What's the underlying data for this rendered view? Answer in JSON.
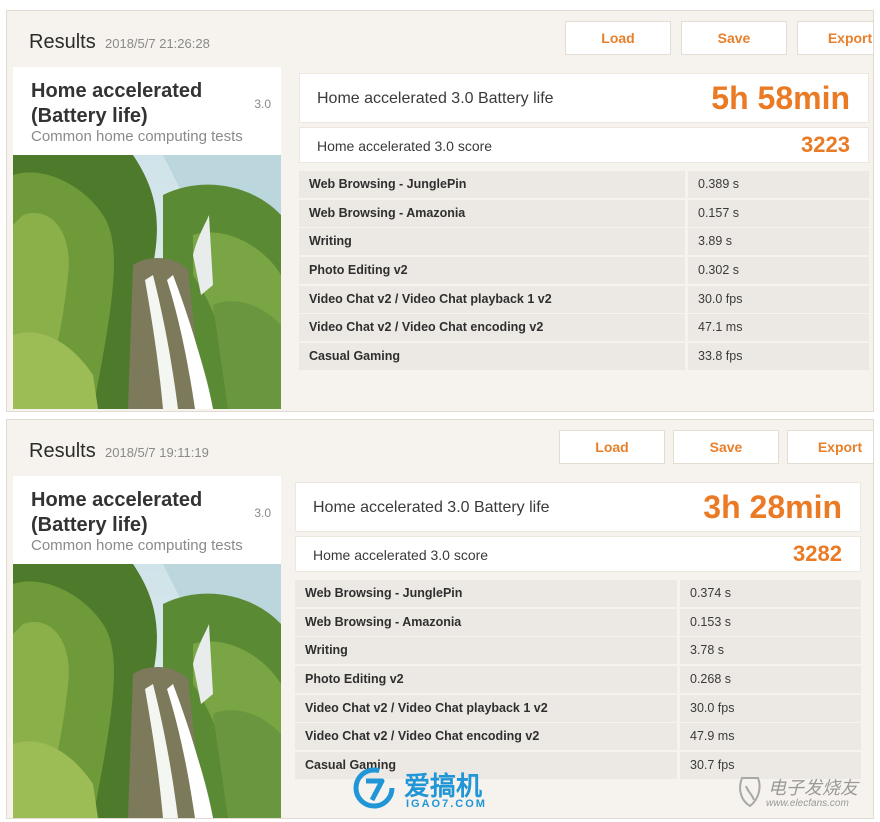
{
  "panels": [
    {
      "header": {
        "title": "Results",
        "date": "2018/5/7 21:26:28"
      },
      "buttons": {
        "load": "Load",
        "save": "Save",
        "export": "Export"
      },
      "test": {
        "name": "Home accelerated (Battery life)",
        "version": "3.0",
        "description": "Common home computing tests"
      },
      "battery": {
        "label": "Home accelerated 3.0 Battery life",
        "value": "5h 58min"
      },
      "score": {
        "label": "Home accelerated 3.0 score",
        "value": "3223"
      },
      "metrics": [
        {
          "name": "Web Browsing - JunglePin",
          "value": "0.389 s"
        },
        {
          "name": "Web Browsing - Amazonia",
          "value": "0.157 s"
        },
        {
          "name": "Writing",
          "value": "3.89 s"
        },
        {
          "name": "Photo Editing v2",
          "value": "0.302 s"
        },
        {
          "name": "Video Chat v2 / Video Chat playback 1 v2",
          "value": "30.0 fps"
        },
        {
          "name": "Video Chat v2 / Video Chat encoding v2",
          "value": "47.1 ms"
        },
        {
          "name": "Casual Gaming",
          "value": "33.8 fps"
        }
      ]
    },
    {
      "header": {
        "title": "Results",
        "date": "2018/5/7 19:11:19"
      },
      "buttons": {
        "load": "Load",
        "save": "Save",
        "export": "Export"
      },
      "test": {
        "name": "Home accelerated (Battery life)",
        "version": "3.0",
        "description": "Common home computing tests"
      },
      "battery": {
        "label": "Home accelerated 3.0 Battery life",
        "value": "3h 28min"
      },
      "score": {
        "label": "Home accelerated 3.0 score",
        "value": "3282"
      },
      "metrics": [
        {
          "name": "Web Browsing - JunglePin",
          "value": "0.374 s"
        },
        {
          "name": "Web Browsing - Amazonia",
          "value": "0.153 s"
        },
        {
          "name": "Writing",
          "value": "3.78 s"
        },
        {
          "name": "Photo Editing v2",
          "value": "0.268 s"
        },
        {
          "name": "Video Chat v2 / Video Chat playback 1 v2",
          "value": "30.0 fps"
        },
        {
          "name": "Video Chat v2 / Video Chat encoding v2",
          "value": "47.9 ms"
        },
        {
          "name": "Casual Gaming",
          "value": "30.7 fps"
        }
      ]
    }
  ],
  "watermarks": {
    "igao7_cn": "爱搞机",
    "igao7_en": "IGAO7.COM",
    "elecfans_cn": "电子发烧友",
    "elecfans_en": "www.elecfans.com"
  },
  "colors": {
    "accent": "#ea7a24",
    "row_bg": "#ece9e4",
    "panel_bg": "#f6f3ee",
    "watermark_blue": "#2196d6"
  }
}
